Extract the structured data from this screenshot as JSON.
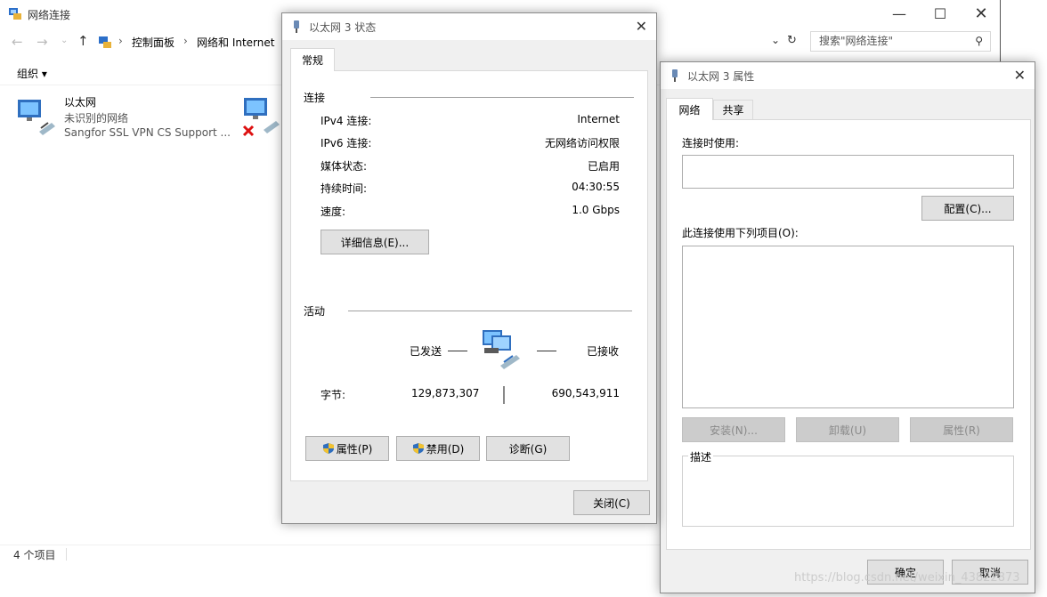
{
  "explorer": {
    "title": "网络连接",
    "breadcrumb": [
      "控制面板",
      "网络和 Internet"
    ],
    "search_placeholder": "搜索\"网络连接\"",
    "organize_label": "组织 ▾",
    "status_text": "4 个项目",
    "items": [
      {
        "name": "以太网",
        "status": "未识别的网络",
        "device": "Sangfor SSL VPN CS Support ..."
      }
    ]
  },
  "status_dialog": {
    "title": "以太网 3 状态",
    "tab": "常规",
    "connection_group": "连接",
    "rows": [
      {
        "label": "IPv4 连接:",
        "value": "Internet"
      },
      {
        "label": "IPv6 连接:",
        "value": "无网络访问权限"
      },
      {
        "label": "媒体状态:",
        "value": "已启用"
      },
      {
        "label": "持续时间:",
        "value": "04:30:55"
      },
      {
        "label": "速度:",
        "value": "1.0 Gbps"
      }
    ],
    "details_button": "详细信息(E)...",
    "activity_group": "活动",
    "sent_label": "已发送",
    "received_label": "已接收",
    "bytes_label": "字节:",
    "bytes_sent": "129,873,307",
    "bytes_received": "690,543,911",
    "properties_button": "属性(P)",
    "disable_button": "禁用(D)",
    "diagnose_button": "诊断(G)",
    "close_button": "关闭(C)"
  },
  "props_dialog": {
    "title": "以太网 3 属性",
    "tabs": [
      "网络",
      "共享"
    ],
    "connect_using_label": "连接时使用:",
    "configure_button": "配置(C)...",
    "items_label": "此连接使用下列项目(O):",
    "install_button": "安装(N)...",
    "uninstall_button": "卸载(U)",
    "properties_button": "属性(R)",
    "description_label": "描述",
    "ok_button": "确定",
    "cancel_button": "取消"
  },
  "watermark": "https://blog.csdn.net/weixin_43822873"
}
